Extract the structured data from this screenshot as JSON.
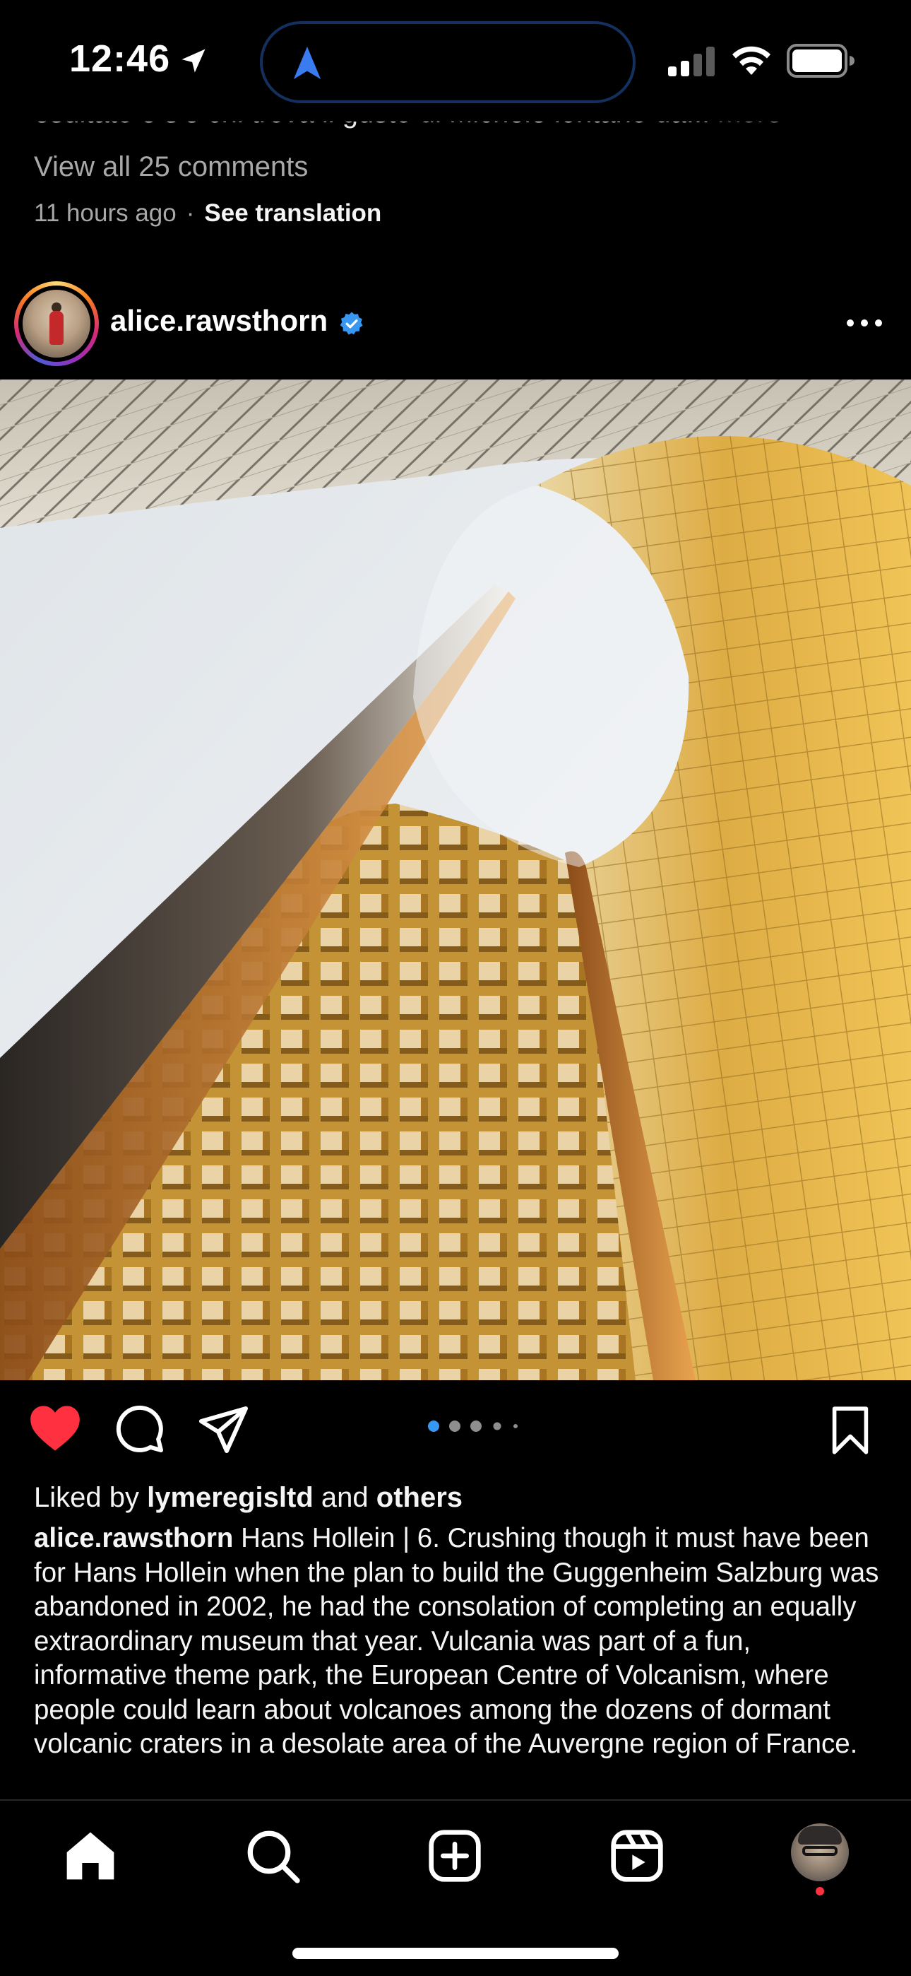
{
  "status_bar": {
    "time": "12:46",
    "location_icon": "location-arrow-icon",
    "island_icon": "navigation-arrow-icon",
    "icons": [
      "cellular-signal-icon",
      "wifi-icon",
      "battery-icon"
    ]
  },
  "previous_post": {
    "caption_fragment": "esultato e s'è chi trova il gusto di Michele lontano da...",
    "more_label": "more",
    "view_comments": "View all 25 comments",
    "timestamp": "11 hours ago",
    "separator": "·",
    "see_translation": "See translation"
  },
  "post": {
    "username": "alice.rawsthorn",
    "verified": true,
    "more_icon": "more-horizontal-icon",
    "liked": true,
    "carousel": {
      "count": 5,
      "active": 1
    },
    "likes": {
      "prefix": "Liked by",
      "user": "lymeregisltd",
      "middle": "and",
      "suffix": "others"
    },
    "caption_user": "alice.rawsthorn",
    "caption_text": "Hans Hollein | 6. Crushing though it must have been for Hans Hollein when the plan to build the Guggenheim Salzburg was abandoned in 2002, he had the consolation of completing an equally extraordinary museum that year. Vulcania was part of a fun, informative theme park, the European Centre of Volcanism, where people could learn about volcanoes among the dozens of dormant volcanic craters in a desolate area of the Auvergne region of France."
  },
  "colors": {
    "accent_blue": "#3897f0",
    "like_red": "#ff3040",
    "muted_text": "#a8a8a8",
    "gold": "#d9a531"
  },
  "tab_bar": {
    "items": [
      "home-icon",
      "search-icon",
      "create-icon",
      "reels-icon",
      "profile-avatar"
    ],
    "profile_has_notification": true
  }
}
